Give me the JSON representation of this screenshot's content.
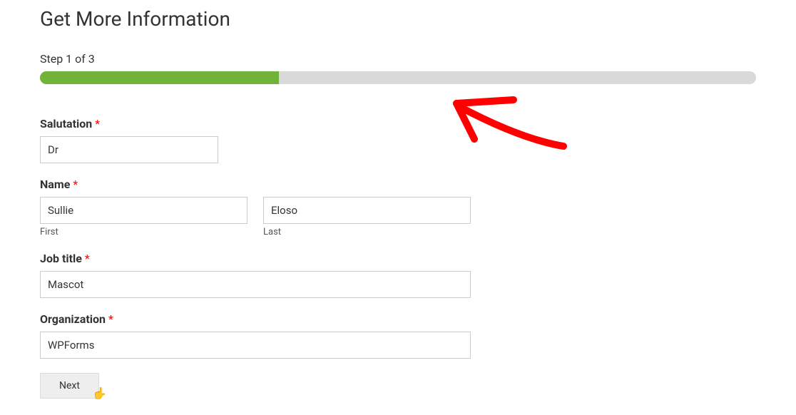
{
  "title": "Get More Information",
  "step_indicator": "Step 1 of 3",
  "progress": {
    "current": 1,
    "total": 3,
    "percent": 33.33
  },
  "fields": {
    "salutation": {
      "label": "Salutation",
      "required": true,
      "value": "Dr"
    },
    "name": {
      "label": "Name",
      "required": true,
      "first": {
        "value": "Sullie",
        "sub_label": "First"
      },
      "last": {
        "value": "Eloso",
        "sub_label": "Last"
      }
    },
    "job_title": {
      "label": "Job title",
      "required": true,
      "value": "Mascot"
    },
    "organization": {
      "label": "Organization",
      "required": true,
      "value": "WPForms"
    }
  },
  "buttons": {
    "next": "Next"
  },
  "required_marker": "*"
}
